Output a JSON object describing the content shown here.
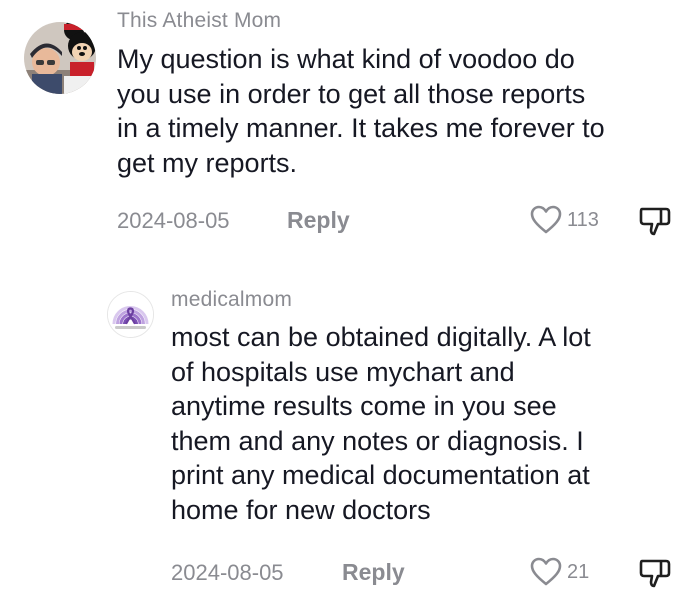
{
  "comments": [
    {
      "username": "This Atheist Mom",
      "text_lines": [
        "My question is what kind of voodoo do",
        "you use in order to get all those reports",
        "in a timely manner. It takes me forever to",
        "get my reports."
      ],
      "date": "2024-08-05",
      "reply_label": "Reply",
      "like_count": "113",
      "avatar_icon": "mickey-mouse-photo-avatar"
    },
    {
      "username": "medicalmom",
      "text_lines": [
        "most can be obtained digitally. A lot",
        "of hospitals use mychart and",
        "anytime results come in you see",
        "them and any notes or diagnosis. I",
        "print any medical documentation at",
        "home for new doctors"
      ],
      "date": "2024-08-05",
      "reply_label": "Reply",
      "like_count": "21",
      "avatar_icon": "purple-rainbow-ribbon-avatar"
    }
  ],
  "colors": {
    "text": "#161823",
    "meta": "#8a8b91",
    "ribbon": "#6b3fa0"
  }
}
